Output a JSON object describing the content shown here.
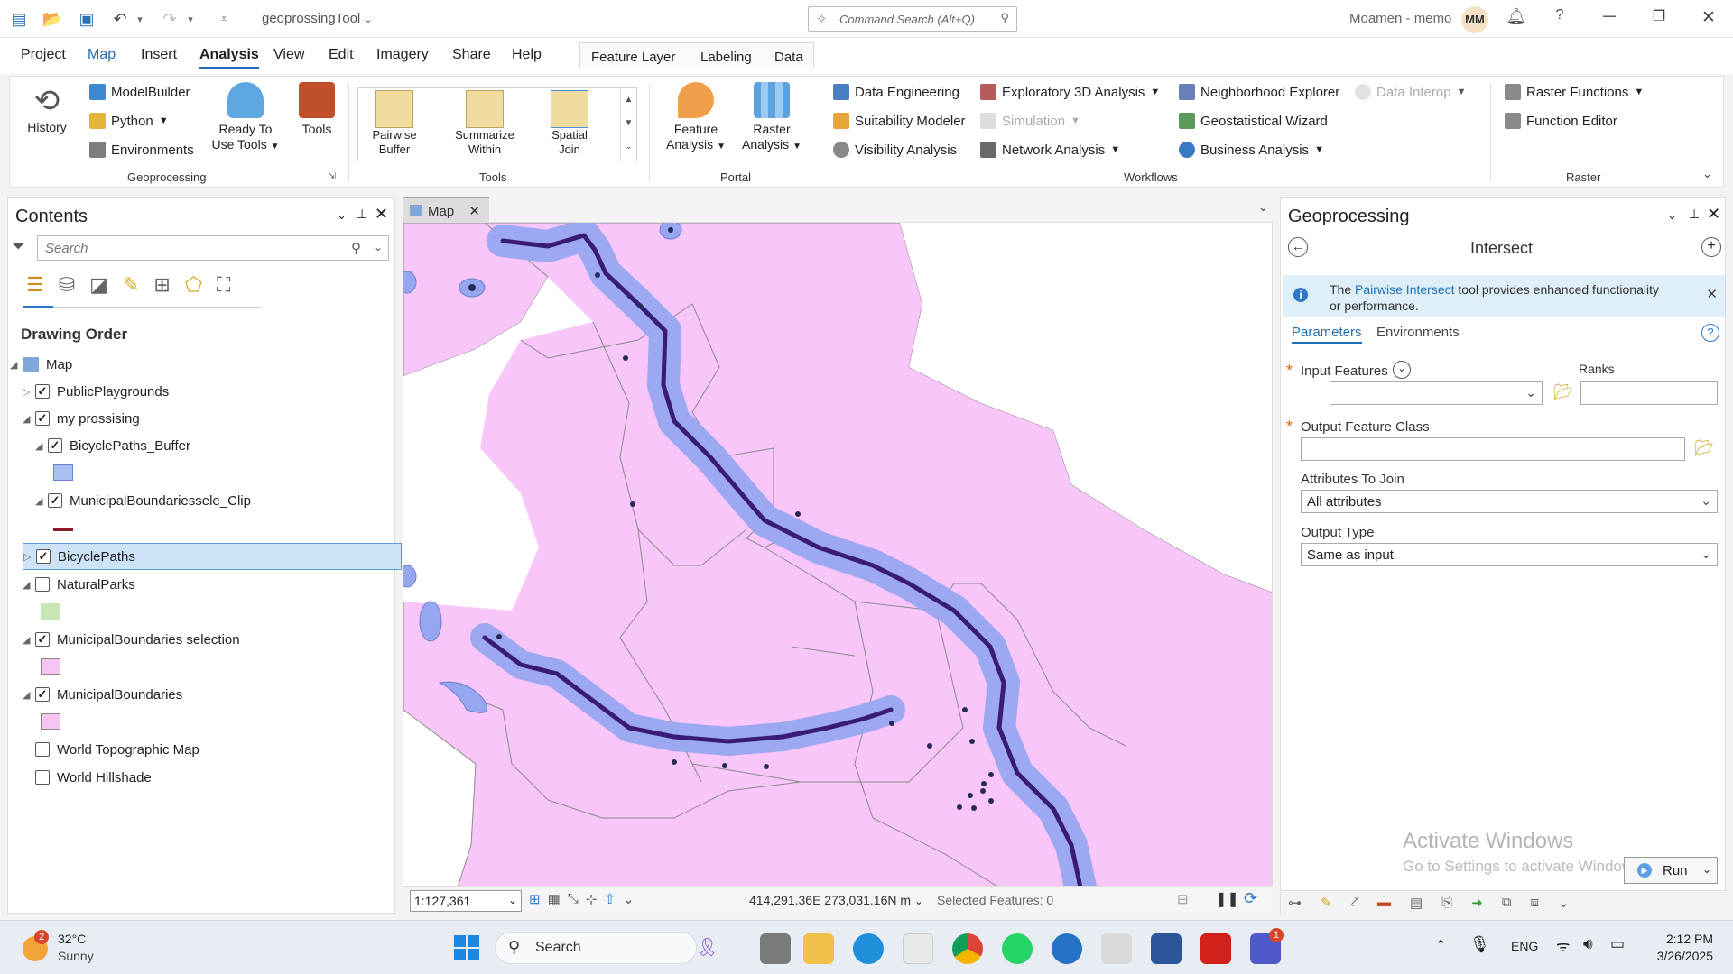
{
  "titlebar": {
    "project_title": "geoprossingTool",
    "command_search_placeholder": "Command Search (Alt+Q)",
    "user_name": "Moamen - memo",
    "user_initials": "MM",
    "help": "?"
  },
  "menu": {
    "project": "Project",
    "map": "Map",
    "insert": "Insert",
    "analysis": "Analysis",
    "view": "View",
    "edit": "Edit",
    "imagery": "Imagery",
    "share": "Share",
    "help": "Help"
  },
  "contextual_tabs": {
    "feature_layer": "Feature Layer",
    "labeling": "Labeling",
    "data": "Data"
  },
  "ribbon": {
    "geoprocessing": {
      "label": "Geoprocessing",
      "history": "History",
      "modelbuilder": "ModelBuilder",
      "python": "Python",
      "environments": "Environments",
      "ready_line1": "Ready To",
      "ready_line2": "Use Tools",
      "tools": "Tools"
    },
    "tools": {
      "label": "Tools",
      "pairwise_line1": "Pairwise",
      "pairwise_line2": "Buffer",
      "summarize_line1": "Summarize",
      "summarize_line2": "Within",
      "spatial_line1": "Spatial",
      "spatial_line2": "Join"
    },
    "portal": {
      "label": "Portal",
      "feature_line1": "Feature",
      "feature_line2": "Analysis",
      "raster_line1": "Raster",
      "raster_line2": "Analysis"
    },
    "workflows": {
      "label": "Workflows",
      "data_engineering": "Data Engineering",
      "suitability": "Suitability Modeler",
      "visibility": "Visibility Analysis",
      "exploratory": "Exploratory 3D Analysis",
      "simulation": "Simulation",
      "network": "Network Analysis",
      "neighborhood": "Neighborhood Explorer",
      "geostatistical": "Geostatistical Wizard",
      "business": "Business Analysis",
      "data_interop": "Data Interop"
    },
    "raster": {
      "label": "Raster",
      "raster_functions": "Raster Functions",
      "function_editor": "Function Editor"
    }
  },
  "contents": {
    "title": "Contents",
    "search_placeholder": "Search",
    "drawing_order": "Drawing Order",
    "layers": [
      {
        "name": "Map"
      },
      {
        "name": "PublicPlaygrounds",
        "checked": true
      },
      {
        "name": "my prossising",
        "checked": true
      },
      {
        "name": "BicyclePaths_Buffer",
        "checked": true,
        "swatch": "#a9c1f2"
      },
      {
        "name": "MunicipalBoundariessele_Clip",
        "checked": true,
        "swatch": "#8a1d2a"
      },
      {
        "name": "BicyclePaths",
        "checked": true
      },
      {
        "name": "NaturalParks",
        "checked": false,
        "swatch": "#c9e6b5"
      },
      {
        "name": "MunicipalBoundaries selection",
        "checked": true,
        "swatch": "#f7c4f4"
      },
      {
        "name": "MunicipalBoundaries",
        "checked": true,
        "swatch": "#f7c4f4"
      },
      {
        "name": "World Topographic Map",
        "checked": false
      },
      {
        "name": "World Hillshade",
        "checked": false
      }
    ]
  },
  "map": {
    "tab": "Map",
    "scale": "1:127,361",
    "coordinates": "414,291.36E 273,031.16N m",
    "selected_features": "Selected Features: 0",
    "polygon_fill": "#f8c6f8",
    "buffer_fill": "#97a6f0",
    "line_color": "#3a1c78"
  },
  "geoprocessing": {
    "title": "Geoprocessing",
    "tool": "Intersect",
    "info_prefix": "The ",
    "info_link": "Pairwise Intersect",
    "info_suffix": " tool provides enhanced functionality",
    "info_line2": "or performance.",
    "tab_parameters": "Parameters",
    "tab_environments": "Environments",
    "input_features": "Input Features",
    "ranks": "Ranks",
    "output_feature_class": "Output Feature Class",
    "attributes_to_join": "Attributes To Join",
    "attributes_value": "All attributes",
    "output_type": "Output Type",
    "output_type_value": "Same as input",
    "activate_title": "Activate Windows",
    "activate_sub": "Go to Settings to activate Windows.",
    "run": "Run"
  },
  "taskbar": {
    "temperature": "32°C",
    "weather": "Sunny",
    "weather_badge": "2",
    "search": "Search",
    "language": "ENG",
    "time": "2:12 PM",
    "date": "3/26/2025",
    "teams_badge": "1"
  }
}
